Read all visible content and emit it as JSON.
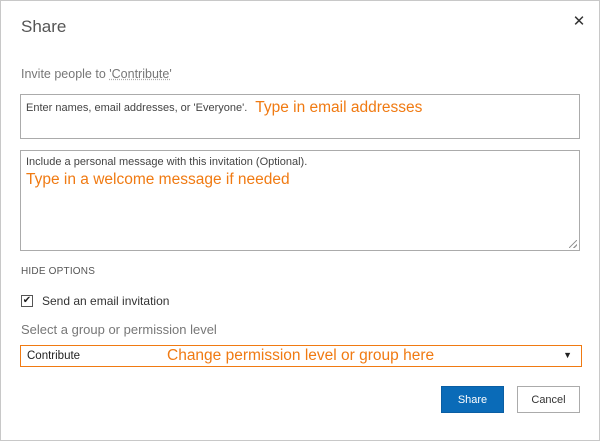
{
  "dialog": {
    "title": "Share",
    "close_glyph": "✕",
    "invite_prefix": "Invite people to ",
    "invite_site": "'Contribute'",
    "names_placeholder": "Enter names, email addresses, or 'Everyone'.",
    "names_annotation": "Type in email addresses",
    "message_placeholder": "Include a personal message with this invitation (Optional).",
    "message_annotation": "Type in a welcome message if needed",
    "hide_options": "HIDE OPTIONS",
    "send_email_label": "Send an email invitation",
    "send_email_checked": true,
    "checkmark_glyph": "✔",
    "permission_label": "Select a group or permission level",
    "permission_value": "Contribute",
    "permission_annotation": "Change permission level or group here",
    "dropdown_glyph": "▼",
    "share_button": "Share",
    "cancel_button": "Cancel"
  },
  "colors": {
    "annotation": "#f07a12",
    "primary_button": "#0a6bb8"
  }
}
